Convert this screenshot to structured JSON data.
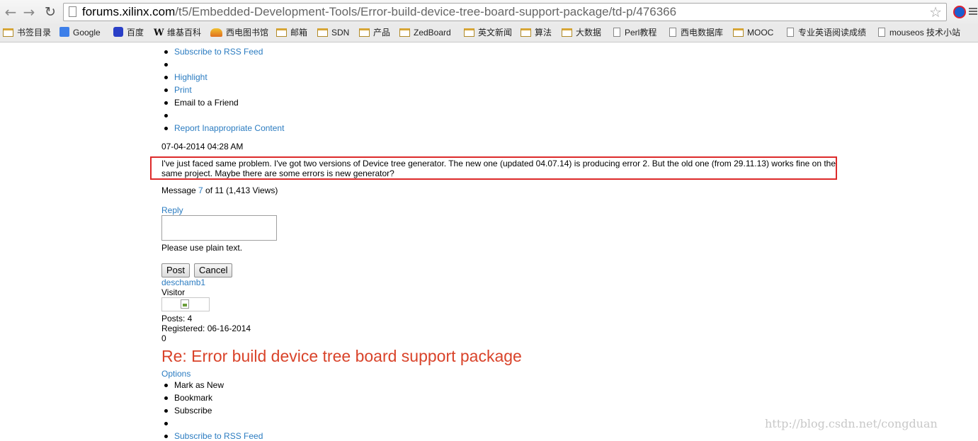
{
  "browser": {
    "url_host": "forums.xilinx.com",
    "url_path": "/t5/Embedded-Development-Tools/Error-build-device-tree-board-support-package/td-p/476366",
    "bookmarks": [
      {
        "label": "书签目录",
        "icon": "folder-icon"
      },
      {
        "label": "Google",
        "icon": "google-icon"
      },
      {
        "label": "百度",
        "icon": "baidu-paw-icon"
      },
      {
        "label": "维基百科",
        "icon": "wikipedia-icon"
      },
      {
        "label": "西电图书馆",
        "icon": "library-icon"
      },
      {
        "label": "邮箱",
        "icon": "folder-icon"
      },
      {
        "label": "SDN",
        "icon": "folder-icon"
      },
      {
        "label": "产品",
        "icon": "folder-icon"
      },
      {
        "label": "ZedBoard",
        "icon": "folder-icon"
      },
      {
        "label": "英文新闻",
        "icon": "folder-icon"
      },
      {
        "label": "算法",
        "icon": "folder-icon"
      },
      {
        "label": "大数据",
        "icon": "folder-icon"
      },
      {
        "label": "Perl教程",
        "icon": "page-icon"
      },
      {
        "label": "西电数据库",
        "icon": "page-icon"
      },
      {
        "label": "MOOC",
        "icon": "folder-icon"
      },
      {
        "label": "专业英语阅读成绩",
        "icon": "page-icon"
      },
      {
        "label": "mouseos 技术小站",
        "icon": "page-icon"
      }
    ]
  },
  "menu_top": {
    "subscribe_rss": "Subscribe to RSS Feed",
    "highlight": "Highlight",
    "print": "Print",
    "email_friend": "Email to a Friend",
    "report": "Report Inappropriate Content"
  },
  "post": {
    "timestamp": "07-04-2014 04:28 AM",
    "body": "I've just faced same problem. I've got two versions of Device tree generator. The new one (updated 04.07.14) is producing error 2. But the old one (from 29.11.13) works fine on the same project. Maybe there are some errors is new generator?",
    "message_prefix": "Message ",
    "message_number": "7",
    "message_suffix": " of 11 (1,413 Views)"
  },
  "reply": {
    "label": "Reply",
    "hint": "Please use plain text.",
    "post_button": "Post",
    "cancel_button": "Cancel"
  },
  "author": {
    "name": "deschamb1",
    "rank": "Visitor",
    "posts": "Posts: 4",
    "registered": "Registered: 06-16-2014",
    "kudos": "0"
  },
  "next_post": {
    "title": "Re: Error build device tree board support package",
    "options": "Options",
    "mark_new": "Mark as New",
    "bookmark": "Bookmark",
    "subscribe": "Subscribe",
    "subscribe_rss": "Subscribe to RSS Feed"
  },
  "watermark": "http://blog.csdn.net/congduan"
}
